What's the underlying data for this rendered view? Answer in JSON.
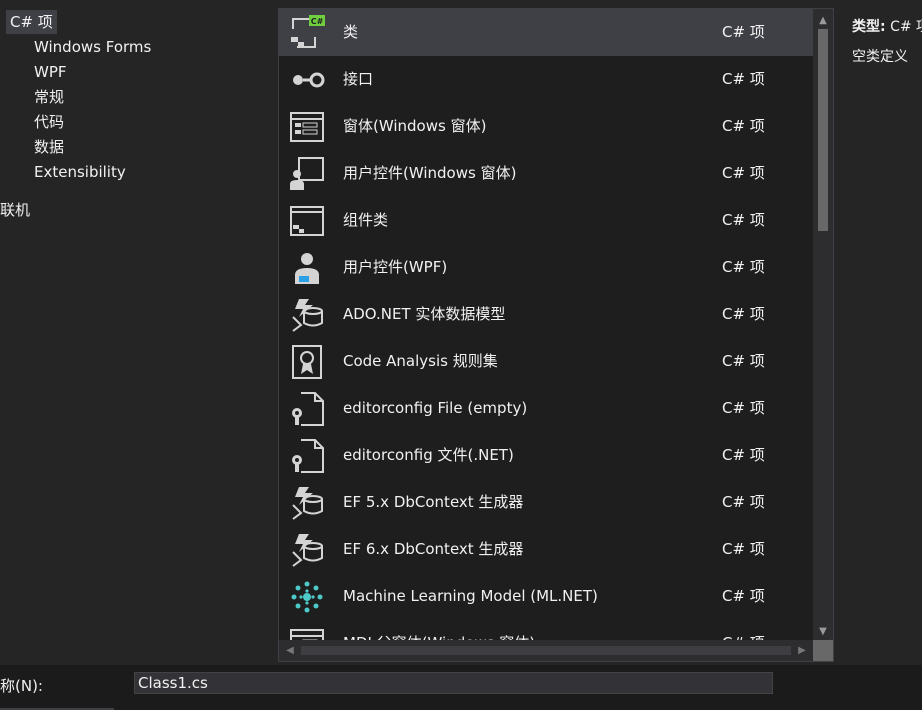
{
  "categories": {
    "root": "C# 项",
    "children": [
      "Windows Forms",
      "WPF",
      "常规",
      "代码",
      "数据",
      "Extensibility"
    ],
    "online": "联机"
  },
  "templates": [
    {
      "name": "类",
      "lang": "C# 项",
      "icon": "class-icon"
    },
    {
      "name": "接口",
      "lang": "C# 项",
      "icon": "interface-icon"
    },
    {
      "name": "窗体(Windows 窗体)",
      "lang": "C# 项",
      "icon": "form-icon"
    },
    {
      "name": "用户控件(Windows 窗体)",
      "lang": "C# 项",
      "icon": "user-control-icon"
    },
    {
      "name": "组件类",
      "lang": "C# 项",
      "icon": "component-class-icon"
    },
    {
      "name": "用户控件(WPF)",
      "lang": "C# 项",
      "icon": "wpf-user-control-icon"
    },
    {
      "name": "ADO.NET 实体数据模型",
      "lang": "C# 项",
      "icon": "entity-model-icon"
    },
    {
      "name": "Code Analysis 规则集",
      "lang": "C# 项",
      "icon": "ruleset-icon"
    },
    {
      "name": "editorconfig File (empty)",
      "lang": "C# 项",
      "icon": "config-file-icon"
    },
    {
      "name": "editorconfig 文件(.NET)",
      "lang": "C# 项",
      "icon": "config-file-icon"
    },
    {
      "name": "EF 5.x DbContext 生成器",
      "lang": "C# 项",
      "icon": "dbcontext-generator-icon"
    },
    {
      "name": "EF 6.x DbContext 生成器",
      "lang": "C# 项",
      "icon": "dbcontext-generator-icon"
    },
    {
      "name": "Machine Learning Model (ML.NET)",
      "lang": "C# 项",
      "icon": "ml-model-icon"
    },
    {
      "name": "MDI 父窗体(Windows 窗体)",
      "lang": "C# 项",
      "icon": "form-icon"
    }
  ],
  "detail": {
    "type_label": "类型:",
    "type_value": "C# 项",
    "description": "空类定义"
  },
  "name_field": {
    "label": "称(N):",
    "value": "Class1.cs"
  },
  "colors": {
    "background": "#252526",
    "list_background": "#1e1e1e",
    "selected_row": "#3f3f46",
    "accent_green": "#6fcf3f",
    "ml_cyan": "#4ec9c9"
  }
}
